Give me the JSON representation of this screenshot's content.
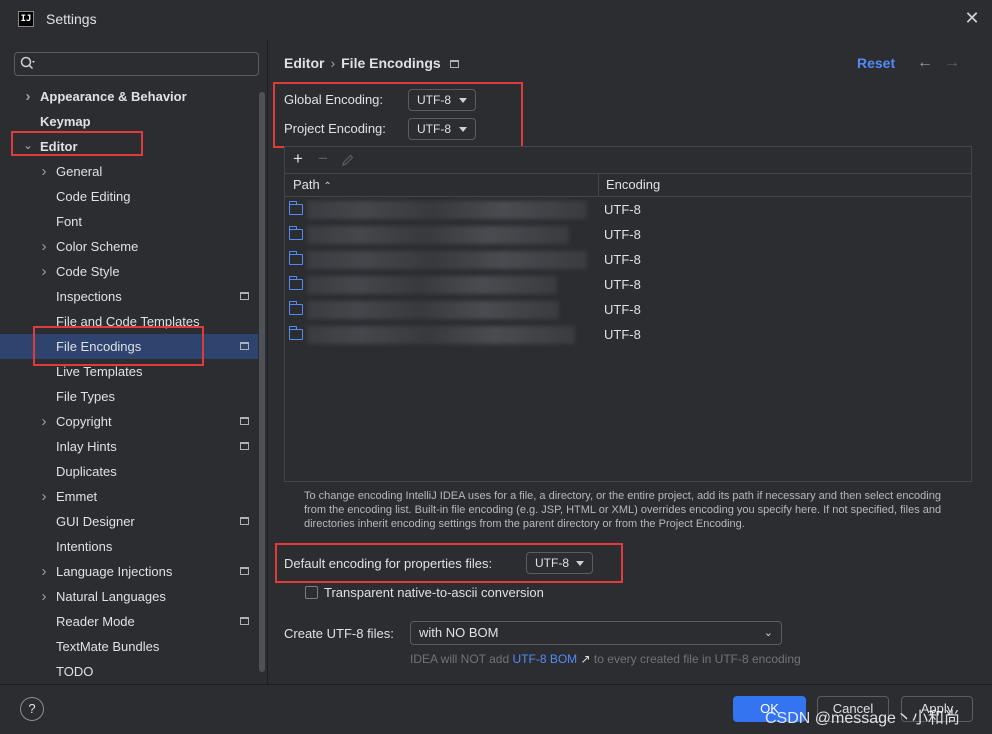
{
  "window": {
    "title": "Settings",
    "app_icon": "IJ"
  },
  "search": {
    "placeholder": ""
  },
  "sidebar": {
    "items": [
      {
        "label": "Appearance & Behavior",
        "level": 0,
        "expandable": true,
        "expanded": false,
        "bold": true,
        "project_icon": false,
        "selected": false
      },
      {
        "label": "Keymap",
        "level": 0,
        "expandable": false,
        "bold": true,
        "project_icon": false,
        "selected": false
      },
      {
        "label": "Editor",
        "level": 0,
        "expandable": true,
        "expanded": true,
        "bold": true,
        "project_icon": false,
        "selected": false
      },
      {
        "label": "General",
        "level": 1,
        "expandable": true,
        "expanded": false,
        "project_icon": false,
        "selected": false
      },
      {
        "label": "Code Editing",
        "level": 1,
        "expandable": false,
        "project_icon": false,
        "selected": false
      },
      {
        "label": "Font",
        "level": 1,
        "expandable": false,
        "project_icon": false,
        "selected": false
      },
      {
        "label": "Color Scheme",
        "level": 1,
        "expandable": true,
        "expanded": false,
        "project_icon": false,
        "selected": false
      },
      {
        "label": "Code Style",
        "level": 1,
        "expandable": true,
        "expanded": false,
        "project_icon": false,
        "selected": false
      },
      {
        "label": "Inspections",
        "level": 1,
        "expandable": false,
        "project_icon": true,
        "selected": false
      },
      {
        "label": "File and Code Templates",
        "level": 1,
        "expandable": false,
        "project_icon": false,
        "selected": false
      },
      {
        "label": "File Encodings",
        "level": 1,
        "expandable": false,
        "project_icon": true,
        "selected": true
      },
      {
        "label": "Live Templates",
        "level": 1,
        "expandable": false,
        "project_icon": false,
        "selected": false
      },
      {
        "label": "File Types",
        "level": 1,
        "expandable": false,
        "project_icon": false,
        "selected": false
      },
      {
        "label": "Copyright",
        "level": 1,
        "expandable": true,
        "expanded": false,
        "project_icon": true,
        "selected": false
      },
      {
        "label": "Inlay Hints",
        "level": 1,
        "expandable": false,
        "project_icon": true,
        "selected": false
      },
      {
        "label": "Duplicates",
        "level": 1,
        "expandable": false,
        "project_icon": false,
        "selected": false
      },
      {
        "label": "Emmet",
        "level": 1,
        "expandable": true,
        "expanded": false,
        "project_icon": false,
        "selected": false
      },
      {
        "label": "GUI Designer",
        "level": 1,
        "expandable": false,
        "project_icon": true,
        "selected": false
      },
      {
        "label": "Intentions",
        "level": 1,
        "expandable": false,
        "project_icon": false,
        "selected": false
      },
      {
        "label": "Language Injections",
        "level": 1,
        "expandable": true,
        "expanded": false,
        "project_icon": true,
        "selected": false
      },
      {
        "label": "Natural Languages",
        "level": 1,
        "expandable": true,
        "expanded": false,
        "project_icon": false,
        "selected": false
      },
      {
        "label": "Reader Mode",
        "level": 1,
        "expandable": false,
        "project_icon": true,
        "selected": false
      },
      {
        "label": "TextMate Bundles",
        "level": 1,
        "expandable": false,
        "project_icon": false,
        "selected": false
      },
      {
        "label": "TODO",
        "level": 1,
        "expandable": false,
        "project_icon": false,
        "selected": false
      }
    ]
  },
  "header": {
    "breadcrumb": [
      "Editor",
      "File Encodings"
    ],
    "reset_label": "Reset"
  },
  "encodings": {
    "global_label": "Global Encoding:",
    "global_value": "UTF-8",
    "project_label": "Project Encoding:",
    "project_value": "UTF-8"
  },
  "table": {
    "columns": [
      "Path",
      "Encoding"
    ],
    "rows": [
      {
        "path": "",
        "encoding": "UTF-8"
      },
      {
        "path": "",
        "encoding": "UTF-8"
      },
      {
        "path": "",
        "encoding": "UTF-8"
      },
      {
        "path": "",
        "encoding": "UTF-8"
      },
      {
        "path": "",
        "encoding": "UTF-8"
      },
      {
        "path": "",
        "encoding": "UTF-8"
      }
    ]
  },
  "help_text": "To change encoding IntelliJ IDEA uses for a file, a directory, or the entire project, add its path if necessary and then select encoding from the encoding list. Built-in file encoding (e.g. JSP, HTML or XML) overrides encoding you specify here. If not specified, files and directories inherit encoding settings from the parent directory or from the Project Encoding.",
  "properties": {
    "label": "Default encoding for properties files:",
    "value": "UTF-8",
    "transparent_label": "Transparent native-to-ascii conversion",
    "transparent_checked": false
  },
  "bom": {
    "label": "Create UTF-8 files:",
    "value": "with NO BOM",
    "hint_prefix": "IDEA will NOT add",
    "hint_link": "UTF-8 BOM",
    "hint_suffix": "to every created file in UTF-8 encoding"
  },
  "footer": {
    "help_label": "?",
    "ok_label": "OK",
    "cancel_label": "Cancel",
    "apply_label": "Apply"
  },
  "watermark": "CSDN @message丶小和尚",
  "colors": {
    "background": "#2b2d30",
    "accent": "#3574f0",
    "link": "#548af7",
    "selection": "#2e436e",
    "annotation_box": "#e03a3a"
  }
}
